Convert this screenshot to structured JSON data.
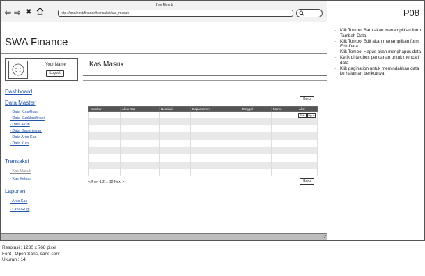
{
  "window": {
    "title": "Kas Masuk",
    "url": "http://localhost/finance/transaksi/kas_masuk"
  },
  "app": {
    "title": "SWA Finance"
  },
  "user": {
    "name": "Your Name",
    "logout_label": "Logout"
  },
  "sidebar": {
    "dashboard": "Dashboard",
    "data_master": {
      "label": "Data Master",
      "items": [
        "- Data Klasifikasi",
        "- Data Subklasifikasi",
        "- Data Akun",
        "- Data Departemen",
        "- Data Arus Kas",
        "- Data Kurs"
      ]
    },
    "transaksi": {
      "label": "Transaksi",
      "items": [
        "- Kas Masuk",
        "- Kas Keluar"
      ]
    },
    "laporan": {
      "label": "Laporan",
      "items": [
        "- Arus Kas",
        "- Laba/Rugi"
      ]
    }
  },
  "main": {
    "title": "Kas Masuk",
    "new_button": "Baru",
    "table": {
      "columns": [
        "Sumber",
        "Akun Kas",
        "Nominal",
        "Departemen",
        "Tanggal",
        "Memo",
        "Aksi"
      ],
      "row_count": 10,
      "edit_label": "Edit",
      "delete_label": "Hpus"
    },
    "pagination": "< Prev  1 2 ... 10  Next >"
  },
  "notes": {
    "page_id": "P08",
    "items": [
      "Klik Tombol Baru akan menampilkan form Tambah Data",
      "Klik Tombol Edit akan menampilkan form Edit Data",
      "Klik Tombol Hapus akan menghapus data",
      "Ketik di textbox pencarian untuk mencari data",
      "Klik pagination untuk memindahkan data ke halaman berikutnya"
    ]
  },
  "spec": {
    "resolution": "Resolusi : 1280 x 768 pixel",
    "font": "Font : Open Sans, sans-serif",
    "size": "Ukuran : 14"
  }
}
